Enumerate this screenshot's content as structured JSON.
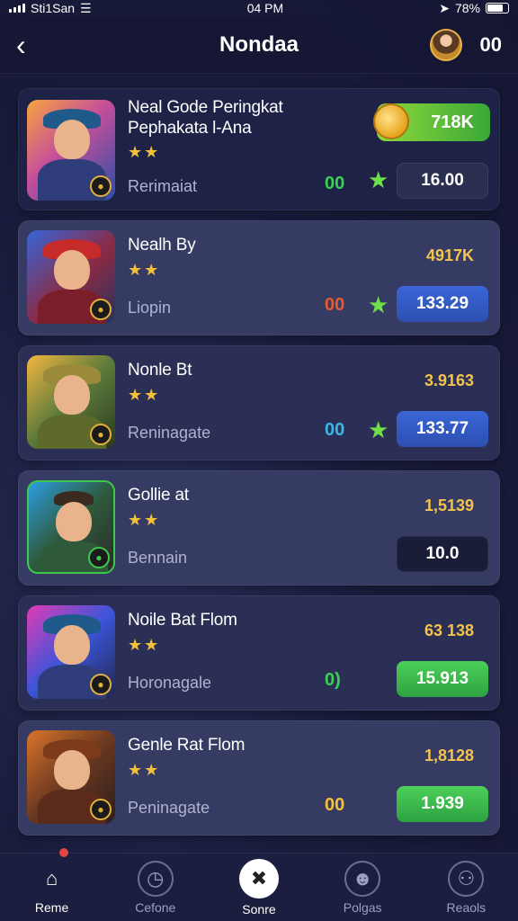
{
  "status_bar": {
    "carrier": "Sti1San",
    "time": "04 PM",
    "battery": "78%"
  },
  "header": {
    "title": "Nondaa",
    "count": "00"
  },
  "items": [
    {
      "title_line1": "Neal Gode Peringkat",
      "title_line2": "Pephakata l-Ana",
      "subtitle": "Rerimaiat",
      "score": "00",
      "price": "16.00",
      "coin_amount": "718K"
    },
    {
      "title_line1": "Nealh By",
      "subtitle": "Liopin",
      "rating": "4917K",
      "score": "00",
      "price": "133.29"
    },
    {
      "title_line1": "Nonle Bt",
      "subtitle": "Reninagate",
      "rating": "3.9163",
      "score": "00",
      "price": "133.77"
    },
    {
      "title_line1": "Gollie at",
      "subtitle": "Bennain",
      "rating": "1,5139",
      "score": "",
      "price": "10.0"
    },
    {
      "title_line1": "Noile Bat Flom",
      "subtitle": "Horonagale",
      "rating": "63 138",
      "score": "0)",
      "price": "15.913"
    },
    {
      "title_line1": "Genle Rat Flom",
      "subtitle": "Peninagate",
      "rating": "1,8128",
      "score": "00",
      "price": "1.939"
    }
  ],
  "tabs": [
    {
      "label": "Reme",
      "icon": "home-icon"
    },
    {
      "label": "Cefone",
      "icon": "clock-icon"
    },
    {
      "label": "Sonre",
      "icon": "cross-icon"
    },
    {
      "label": "Polgas",
      "icon": "face-icon"
    },
    {
      "label": "Reaols",
      "icon": "person-icon"
    }
  ],
  "colors": {
    "accent_green": "#39d154",
    "accent_blue": "#3a66d6",
    "rating_gold": "#f3c34b",
    "background": "#1a1d3d"
  }
}
